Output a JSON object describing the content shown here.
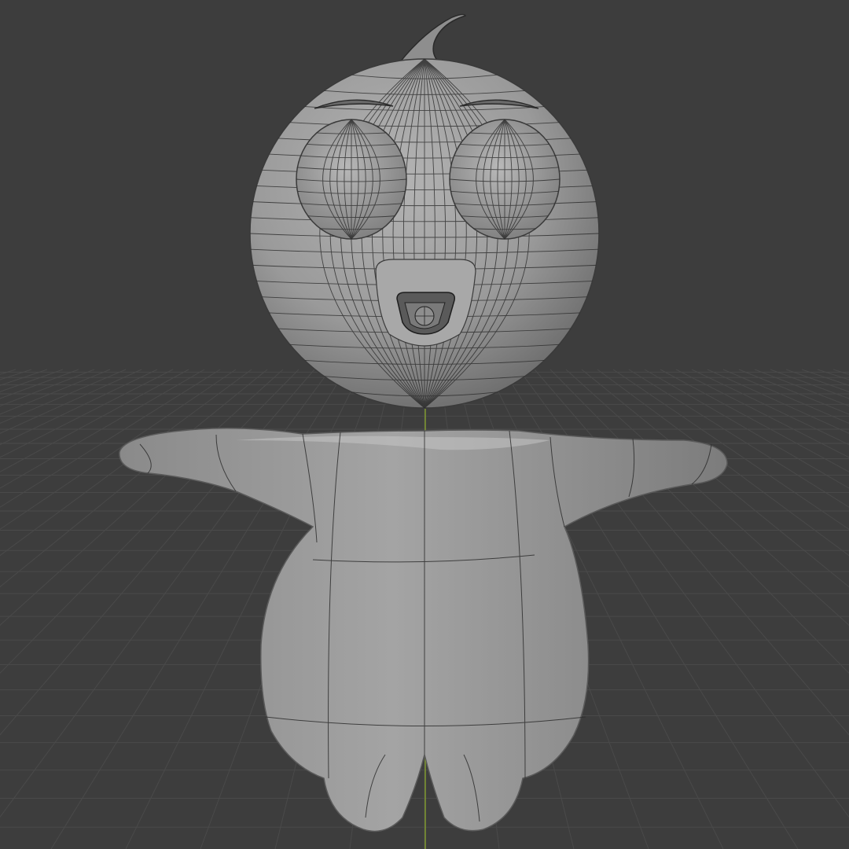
{
  "app": {
    "name": "3D viewport",
    "view": "front-orthographic-solid-wireframe-overlay"
  },
  "viewport": {
    "background_color": "#3d3d3d",
    "grid_color": "#4a4a4a",
    "axis_color_y": "#8fae2a",
    "mesh_color": "#9a9a9a",
    "wire_color": "#2a2a2a"
  },
  "scene": {
    "object": "cartoon-character-mesh",
    "parts": [
      "head",
      "hair-curl",
      "left-eye",
      "right-eye",
      "left-eyelid",
      "right-eyelid",
      "snout",
      "mouth",
      "torso",
      "left-arm",
      "right-arm",
      "left-leg",
      "right-leg"
    ]
  }
}
